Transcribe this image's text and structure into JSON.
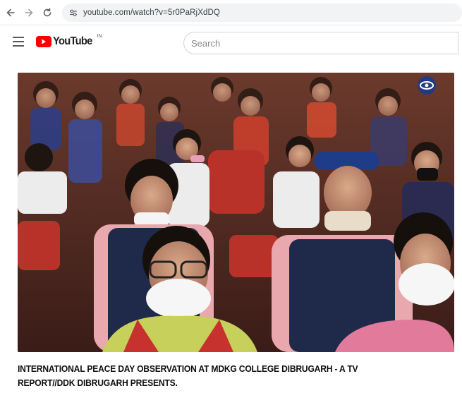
{
  "browser": {
    "url": "youtube.com/watch?v=5r0PaRjXdDQ",
    "back_icon": "arrow-left-icon",
    "forward_icon": "arrow-right-icon",
    "reload_icon": "reload-icon",
    "site_info_icon": "tune-icon"
  },
  "header": {
    "menu_icon": "hamburger-menu-icon",
    "logo_text": "YouTube",
    "logo_region": "IN",
    "search_placeholder": "Search"
  },
  "player": {
    "channel_watermark": "doordarshan-logo"
  },
  "video": {
    "title": "INTERNATIONAL PEACE DAY OBSERVATION AT MDKG COLLEGE DIBRUGARH - A TV REPORT//DDK DIBRUGARH PRESENTS."
  },
  "colors": {
    "brand_red": "#ff0000",
    "omnibox_bg": "#f1f3f4",
    "search_border": "#d3d3d3"
  }
}
